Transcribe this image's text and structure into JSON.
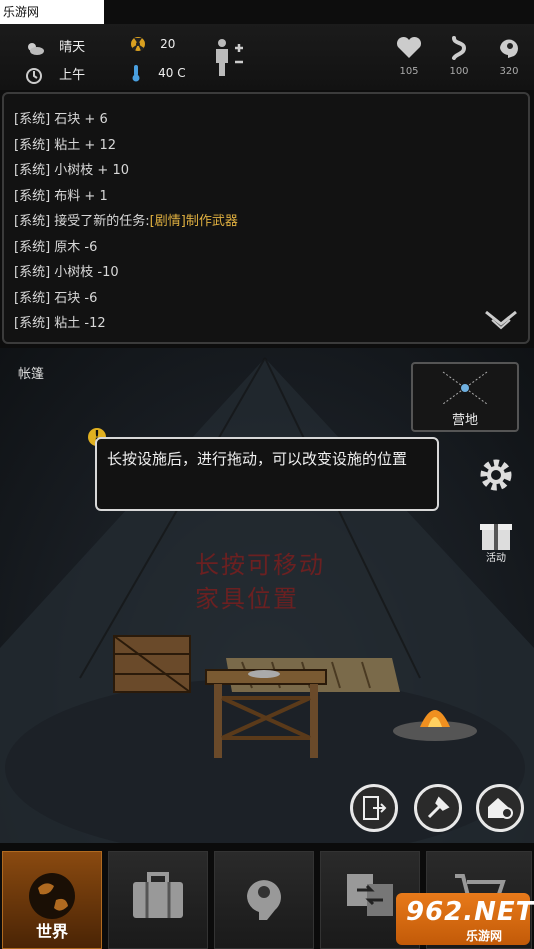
{
  "watermark": "乐游网 www.962.net",
  "status": {
    "weather": "晴天",
    "time_of_day": "上午",
    "radiation": "20",
    "temperature": "40 C",
    "health": "105",
    "hunger": "100",
    "mind": "320"
  },
  "log": {
    "lines": [
      {
        "prefix": "[系统] ",
        "text": "石块 + 6",
        "highlight": ""
      },
      {
        "prefix": "[系统] ",
        "text": "粘土 + 12",
        "highlight": ""
      },
      {
        "prefix": "[系统] ",
        "text": "小树枝 + 10",
        "highlight": ""
      },
      {
        "prefix": "[系统] ",
        "text": "布料 + 1",
        "highlight": ""
      },
      {
        "prefix": "[系统] ",
        "text": "接受了新的任务:",
        "highlight": "[剧情]制作武器"
      },
      {
        "prefix": "[系统] ",
        "text": "原木 -6",
        "highlight": ""
      },
      {
        "prefix": "[系统] ",
        "text": "小树枝 -10",
        "highlight": ""
      },
      {
        "prefix": "[系统] ",
        "text": "石块 -6",
        "highlight": ""
      },
      {
        "prefix": "[系统] ",
        "text": "粘土 -12",
        "highlight": ""
      }
    ]
  },
  "scene": {
    "location_label": "帐篷",
    "map_label": "营地",
    "tooltip": "长按设施后，进行拖动，可以改变设施的位置",
    "wall_text_line1": "长按可移动",
    "wall_text_line2": "家具位置",
    "activity_label": "活动"
  },
  "nav": {
    "world_label": "世界"
  },
  "logo": {
    "big": "962.NET",
    "small": "乐游网"
  },
  "colors": {
    "highlight": "#e0b040",
    "active_tab": "#8a4a10"
  },
  "icons": [
    "sun-cloud-icon",
    "clock-icon",
    "radiation-icon",
    "thermometer-icon",
    "body-icon",
    "heart-icon",
    "stomach-icon",
    "brain-icon",
    "chevron-down-icon",
    "gear-icon",
    "gift-icon",
    "exit-icon",
    "build-icon",
    "home-gear-icon",
    "globe-icon",
    "suitcase-icon",
    "head-gears-icon",
    "exchange-icon",
    "cart-icon"
  ]
}
